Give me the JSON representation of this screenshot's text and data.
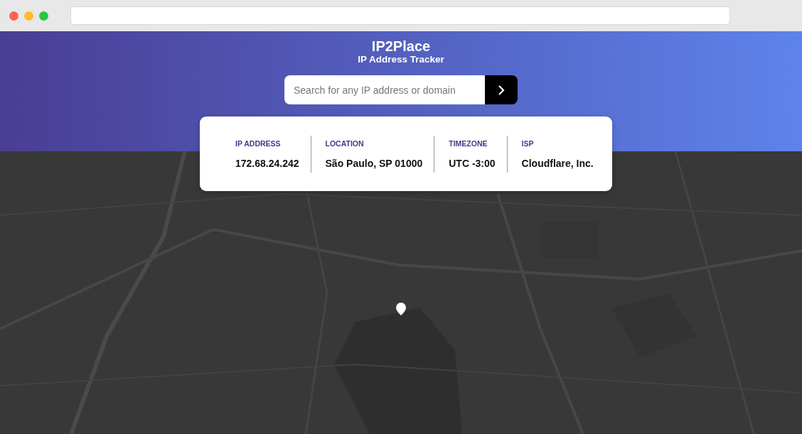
{
  "header": {
    "title": "IP2Place",
    "subtitle": "IP Address Tracker"
  },
  "search": {
    "placeholder": "Search for any IP address or domain"
  },
  "info": [
    {
      "label": "IP ADDRESS",
      "value": "172.68.24.242"
    },
    {
      "label": "LOCATION",
      "value": "São Paulo, SP 01000"
    },
    {
      "label": "TIMEZONE",
      "value": "UTC -3:00"
    },
    {
      "label": "ISP",
      "value": "Cloudflare, Inc."
    }
  ]
}
